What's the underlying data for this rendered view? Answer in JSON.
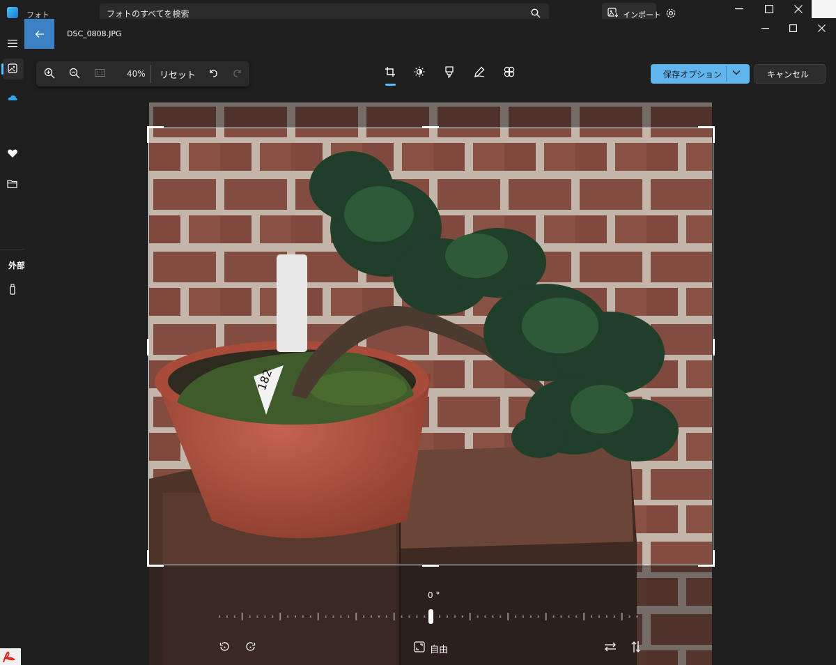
{
  "background_app": {
    "title": "フォト",
    "search_placeholder": "フォトのすべてを検索",
    "import_label": "インポート",
    "sidebar_section_label": "外部"
  },
  "editor": {
    "file_name": "DSC_0808.JPG",
    "zoom_percent": "40%",
    "reset_label": "リセット",
    "active_tool": "crop",
    "tools": [
      "crop",
      "adjust",
      "markup",
      "draw",
      "filter"
    ],
    "save_label": "保存オプション",
    "cancel_label": "キャンセル",
    "rotation_angle": "0 °",
    "aspect_ratio_label": "自由",
    "accent_color": "#60b5ec"
  },
  "photo": {
    "pot_tag_number": "182"
  }
}
